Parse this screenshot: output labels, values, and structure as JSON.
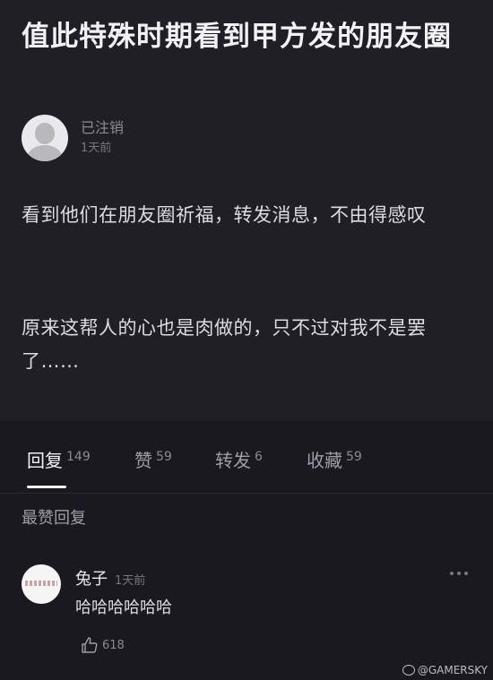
{
  "post": {
    "title": "值此特殊时期看到甲方发的朋友圈",
    "author": "已注销",
    "time": "1天前",
    "paragraphs": [
      "看到他们在朋友圈祈福，转发消息，不由得感叹",
      "原来这帮人的心也是肉做的，只不过对我不是罢了……"
    ]
  },
  "tabs": [
    {
      "label": "回复",
      "count": "149",
      "active": true
    },
    {
      "label": "赞",
      "count": "59",
      "active": false
    },
    {
      "label": "转发",
      "count": "6",
      "active": false
    },
    {
      "label": "收藏",
      "count": "59",
      "active": false
    }
  ],
  "replies_section": {
    "heading": "最赞回复"
  },
  "reply": {
    "name": "兔子",
    "time": "1天前",
    "text": "哈哈哈哈哈哈",
    "likes": "618"
  },
  "watermark": {
    "text": "@GAMERSKY"
  },
  "icons": {
    "avatar": "default-user-avatar-icon",
    "more": "more-dots-icon",
    "like": "thumbs-up-icon",
    "watermark": "weibo-logo-icon"
  },
  "colors": {
    "background": "#1a191f",
    "post_background": "#201f25",
    "text_primary": "#f2f2f4",
    "text_secondary": "#8b8a92"
  }
}
